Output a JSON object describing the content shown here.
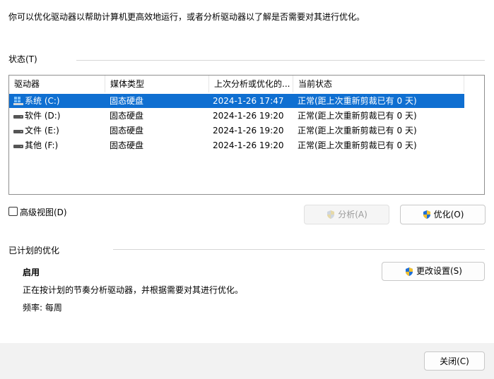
{
  "intro": "你可以优化驱动器以帮助计算机更高效地运行，或者分析驱动器以了解是否需要对其进行优化。",
  "status_label": "状态(T)",
  "columns": [
    "驱动器",
    "媒体类型",
    "上次分析或优化的...",
    "当前状态"
  ],
  "drives": [
    {
      "name": "系统 (C:)",
      "media": "固态硬盘",
      "last": "2024-1-26 17:47",
      "status": "正常(距上次重新剪裁已有 0 天)",
      "icon": "windows-drive-icon",
      "selected": true
    },
    {
      "name": "软件 (D:)",
      "media": "固态硬盘",
      "last": "2024-1-26 19:20",
      "status": "正常(距上次重新剪裁已有 0 天)",
      "icon": "drive-icon",
      "selected": false
    },
    {
      "name": "文件 (E:)",
      "media": "固态硬盘",
      "last": "2024-1-26 19:20",
      "status": "正常(距上次重新剪裁已有 0 天)",
      "icon": "drive-icon",
      "selected": false
    },
    {
      "name": "其他 (F:)",
      "media": "固态硬盘",
      "last": "2024-1-26 19:20",
      "status": "正常(距上次重新剪裁已有 0 天)",
      "icon": "drive-icon",
      "selected": false
    }
  ],
  "advanced_view": "高级视图(D)",
  "analyze_button": "分析(A)",
  "optimize_button": "优化(O)",
  "scheduled_label": "已计划的优化",
  "schedule_state": "启用",
  "schedule_desc": "正在按计划的节奏分析驱动器，并根据需要对其进行优化。",
  "frequency": "频率: 每周",
  "change_settings_button": "更改设置(S)",
  "close_button": "关闭(C)",
  "colors": {
    "selection": "#0f6fd1",
    "footer": "#f2f2f2"
  }
}
